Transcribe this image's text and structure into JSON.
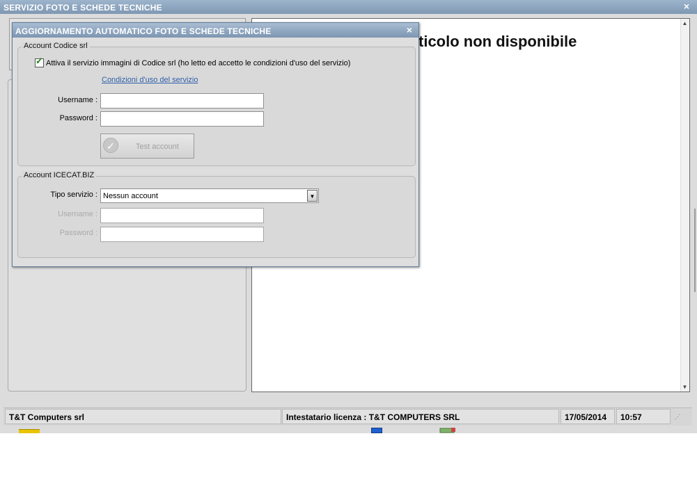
{
  "main_window": {
    "title": "SERVIZIO FOTO E SCHEDE TECNICHE",
    "close_symbol": "×",
    "article_message": "ticolo non disponibile"
  },
  "status_bar": {
    "company": "T&T Computers srl",
    "license": "Intestatario licenza : T&T COMPUTERS SRL",
    "date": "17/05/2014",
    "time": "10:57"
  },
  "dialog": {
    "title": "AGGIORNAMENTO AUTOMATICO FOTO E SCHEDE TECNICHE",
    "close_symbol": "×",
    "codice_group": {
      "legend": "Account Codice srl",
      "checkbox_label": "Attiva il servizio immagini di Codice srl (ho letto ed accetto le condizioni d'uso del servizio)",
      "checkbox_checked": true,
      "terms_link": "Condizioni d'uso del servizio",
      "username_label": "Username :",
      "username_value": "",
      "password_label": "Password :",
      "password_value": "",
      "test_button": "Test account",
      "test_button_icon": "checkmark-circle-icon"
    },
    "icecat_group": {
      "legend": "Account ICECAT.BIZ",
      "service_label": "Tipo servizio :",
      "service_value": "Nessun account",
      "username_label": "Username :",
      "username_value": "",
      "password_label": "Password :",
      "password_value": ""
    }
  },
  "colors": {
    "title_bar": "#7f98b3",
    "link": "#2e5fa8",
    "check": "#1a7f1a"
  }
}
